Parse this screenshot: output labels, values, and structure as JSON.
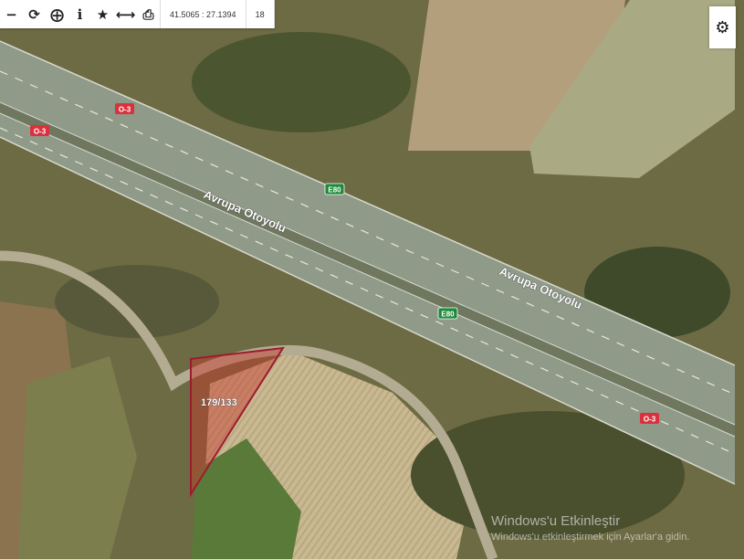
{
  "toolbar": {
    "coordinates": "41.5065 : 27.1394",
    "zoom": "18",
    "buttons": [
      "zoom-out",
      "refresh",
      "locate",
      "info",
      "favorite",
      "measure",
      "print"
    ]
  },
  "map": {
    "road_name": "Avrupa Otoyolu",
    "shield_e80": "E80",
    "shield_o3": "O-3",
    "parcel_label": "179/133",
    "colors": {
      "parcel_outline": "#9b1c2e",
      "parcel_fill": "#c8372d",
      "shield_green": "#1f8a3b",
      "shield_red": "#d9323e"
    }
  },
  "watermark": {
    "title": "Windows'u Etkinleştir",
    "subtitle": "Windows'u etkinleştirmek için Ayarlar'a gidin."
  }
}
